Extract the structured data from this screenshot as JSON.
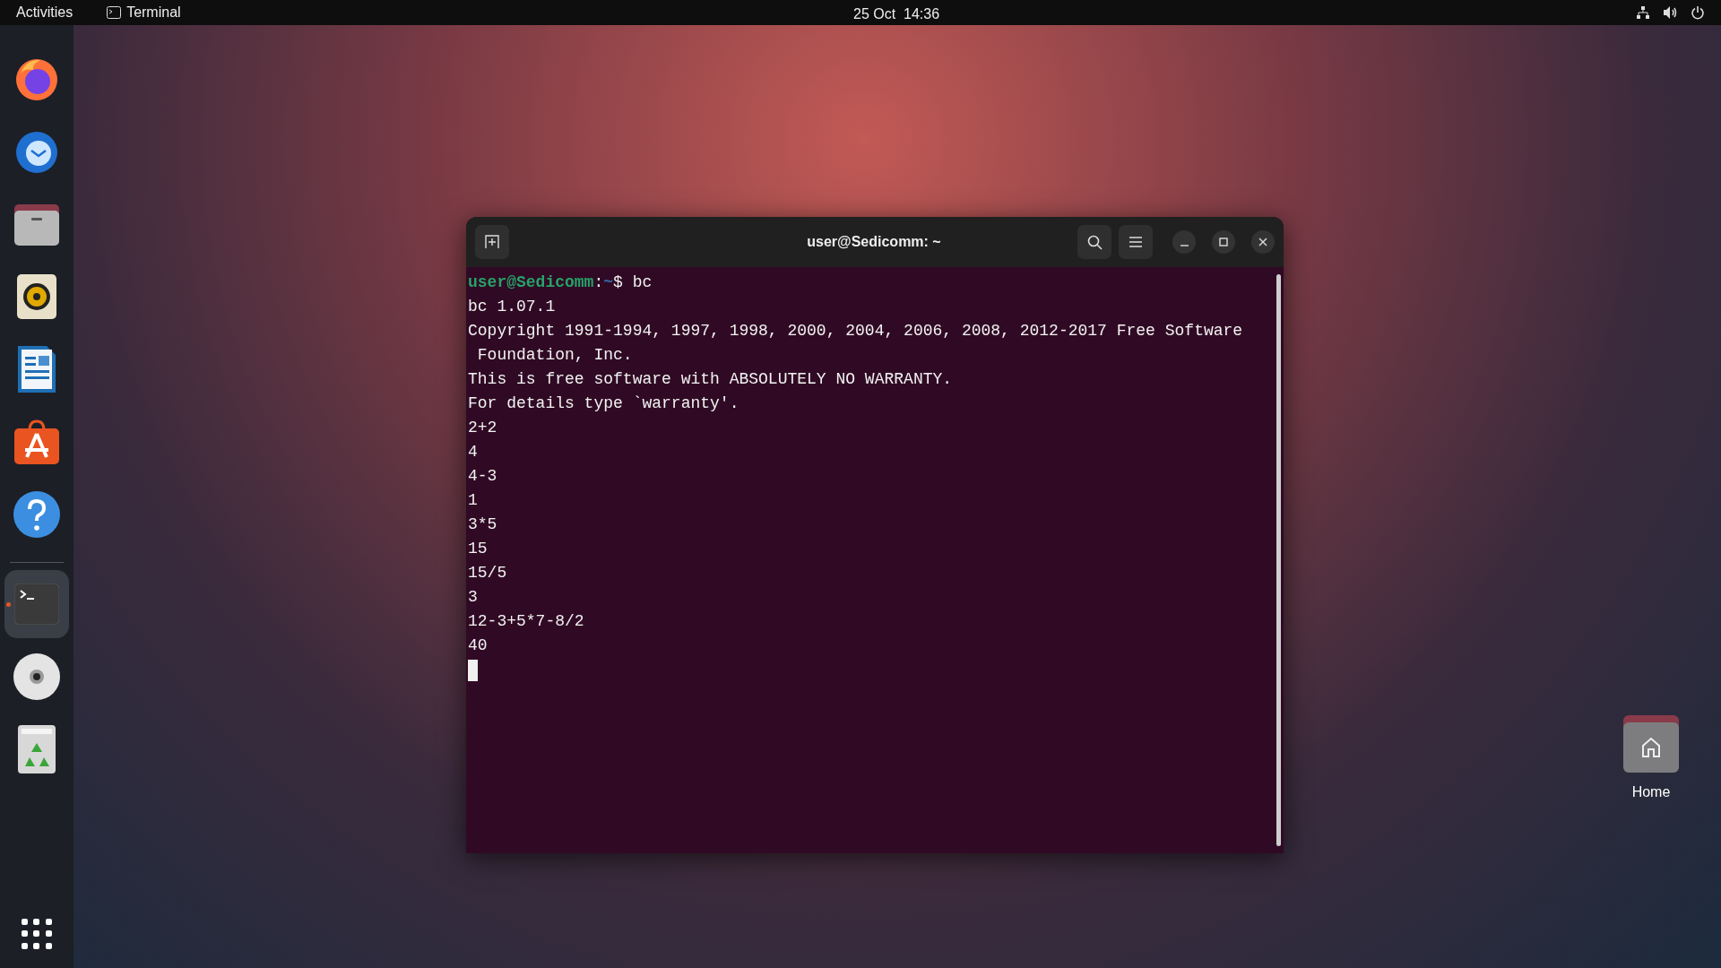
{
  "top_bar": {
    "activities": "Activities",
    "app_menu": "Terminal",
    "clock": "25 Oct  14:36"
  },
  "dock": {
    "apps": [
      {
        "kind": "firefox",
        "running": false
      },
      {
        "kind": "thunderbird",
        "running": false
      },
      {
        "kind": "files",
        "running": false
      },
      {
        "kind": "rhythmbox",
        "running": false
      },
      {
        "kind": "writer",
        "running": false
      },
      {
        "kind": "software",
        "running": false
      },
      {
        "kind": "help",
        "running": false
      },
      {
        "kind": "terminal",
        "running": true
      },
      {
        "kind": "disc",
        "running": false
      },
      {
        "kind": "trash",
        "running": false
      }
    ]
  },
  "window": {
    "title": "user@Sedicomm: ~"
  },
  "terminal": {
    "lines": [
      {
        "kind": "prompt",
        "user_host": "user@Sedicomm",
        "separator": ":",
        "path": "~",
        "symbol": "$",
        "command": "bc"
      },
      {
        "kind": "output",
        "text": "bc 1.07.1"
      },
      {
        "kind": "output",
        "text": "Copyright 1991-1994, 1997, 1998, 2000, 2004, 2006, 2008, 2012-2017 Free Software"
      },
      {
        "kind": "output",
        "text": " Foundation, Inc."
      },
      {
        "kind": "output",
        "text": "This is free software with ABSOLUTELY NO WARRANTY."
      },
      {
        "kind": "output",
        "text": "For details type `warranty'."
      },
      {
        "kind": "output",
        "text": "2+2"
      },
      {
        "kind": "output",
        "text": "4"
      },
      {
        "kind": "output",
        "text": "4-3"
      },
      {
        "kind": "output",
        "text": "1"
      },
      {
        "kind": "output",
        "text": "3*5"
      },
      {
        "kind": "output",
        "text": "15"
      },
      {
        "kind": "output",
        "text": "15/5"
      },
      {
        "kind": "output",
        "text": "3"
      },
      {
        "kind": "output",
        "text": "12-3+5*7-8/2"
      },
      {
        "kind": "output",
        "text": "40"
      },
      {
        "kind": "cursor"
      }
    ]
  },
  "desktop_icons": [
    {
      "label": "Home"
    }
  ]
}
